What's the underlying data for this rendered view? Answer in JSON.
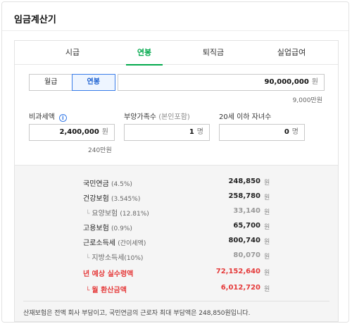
{
  "app_title": "임금계산기",
  "tabs": [
    {
      "label": "시급"
    },
    {
      "label": "연봉"
    },
    {
      "label": "퇴직금"
    },
    {
      "label": "실업급여"
    }
  ],
  "active_tab": "연봉",
  "pay_type": {
    "options": [
      "월급",
      "연봉"
    ],
    "selected": "연봉"
  },
  "salary": {
    "value": "90,000,000",
    "unit": "원",
    "hint": "9,000만원"
  },
  "tax_free": {
    "label": "비과세액",
    "value": "2,400,000",
    "unit": "원",
    "hint": "240만원",
    "info_icon": "i"
  },
  "dependents": {
    "label": "부양가족수",
    "label_sub": "(본인포함)",
    "value": "1",
    "unit": "명"
  },
  "children": {
    "label": "20세 이하 자녀수",
    "value": "0",
    "unit": "명"
  },
  "results": [
    {
      "label": "국민연금",
      "rate": "(4.5%)",
      "value": "248,850",
      "unit": "원"
    },
    {
      "label": "건강보험",
      "rate": "(3.545%)",
      "value": "258,780",
      "unit": "원"
    },
    {
      "label": "요양보험",
      "rate": "(12.81%)",
      "value": "33,140",
      "unit": "원"
    },
    {
      "label": "고용보험",
      "rate": "(0.9%)",
      "value": "65,700",
      "unit": "원"
    },
    {
      "label": "근로소득세",
      "rate": "(간이세액)",
      "value": "800,740",
      "unit": "원"
    },
    {
      "label": "지방소득세",
      "rate": "(10%)",
      "value": "80,070",
      "unit": "원"
    },
    {
      "label": "년 예상 실수령액",
      "rate": "",
      "value": "72,152,640",
      "unit": "원"
    },
    {
      "label": "월 환산금액",
      "rate": "",
      "value": "6,012,720",
      "unit": "원"
    }
  ],
  "note": "산재보험은 전액 회사 부담이고, 국민연금의 근로자 최대 부담액은 248,850원입니다.",
  "colors": {
    "accent_green": "#03a94d",
    "accent_blue": "#3a7de8",
    "highlight_red": "#e53a3a"
  }
}
